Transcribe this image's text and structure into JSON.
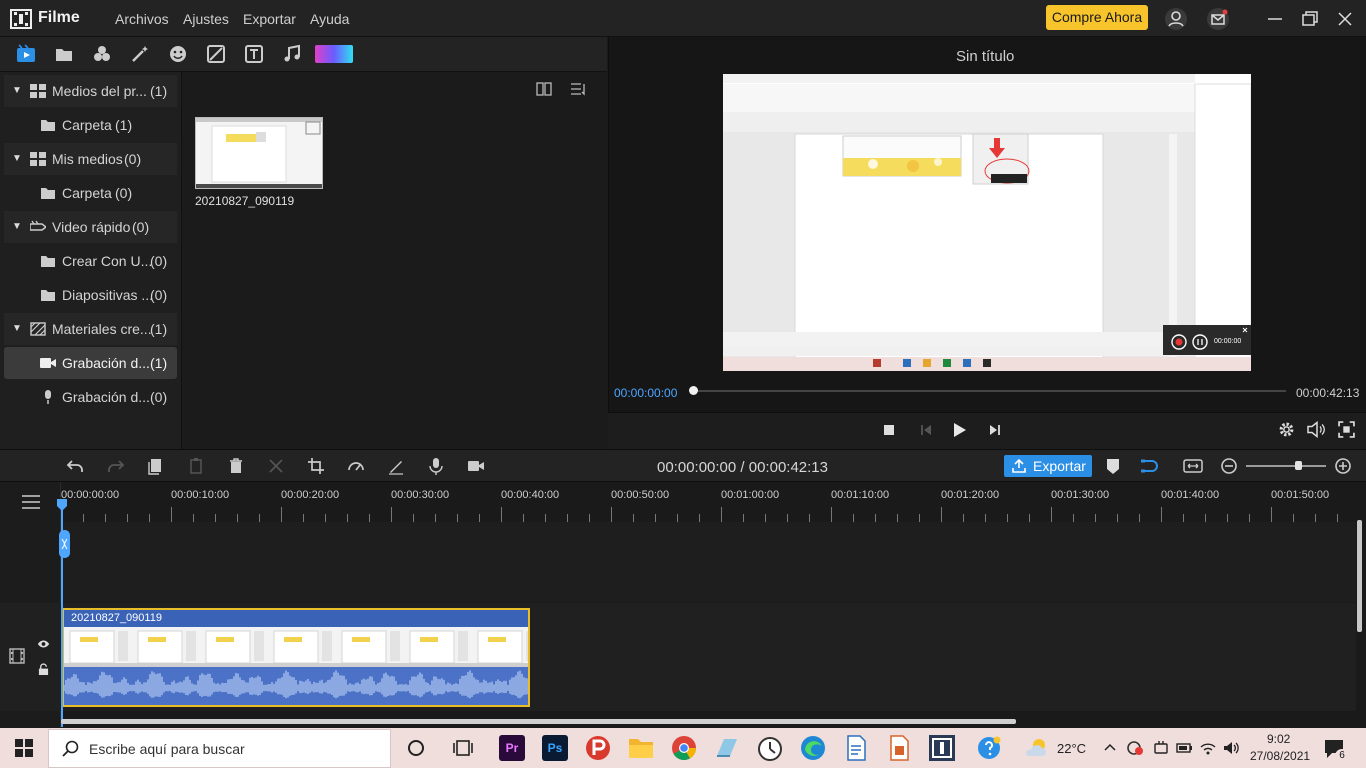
{
  "app": {
    "name": "Filme",
    "menu": [
      "Archivos",
      "Ajustes",
      "Exportar",
      "Ayuda"
    ],
    "buy_button": "Compre Ahora",
    "brand_color": "#f7c52b",
    "accent_color": "#2b8fe6"
  },
  "media_toolbar": {
    "icons": [
      "media-icon",
      "folder-icon",
      "effects-icon",
      "magic-icon",
      "sticker-icon",
      "transitions-icon",
      "text-icon",
      "music-icon",
      "color-icon"
    ]
  },
  "sidebar": {
    "items": [
      {
        "label": "Medios del pr...",
        "count": "(1)",
        "level": 0
      },
      {
        "label": "Carpeta",
        "count": "(1)",
        "level": 1
      },
      {
        "label": "Mis medios",
        "count": "(0)",
        "level": 0
      },
      {
        "label": "Carpeta",
        "count": "(0)",
        "level": 1
      },
      {
        "label": "Video rápido",
        "count": "(0)",
        "level": 0
      },
      {
        "label": "Crear Con U...",
        "count": "(0)",
        "level": 1
      },
      {
        "label": "Diapositivas ...",
        "count": "(0)",
        "level": 1
      },
      {
        "label": "Materiales cre...",
        "count": "(1)",
        "level": 0
      },
      {
        "label": "Grabación d...",
        "count": "(1)",
        "level": 1,
        "selected": true
      },
      {
        "label": "Grabación d...",
        "count": "(0)",
        "level": 1
      }
    ]
  },
  "library": {
    "media_items": [
      {
        "name": "20210827_090119"
      }
    ]
  },
  "preview": {
    "title": "Sin título",
    "current_time": "00:00:00:00",
    "end_time": "00:00:42:13",
    "overlay_time": "00:00:00"
  },
  "timeline": {
    "timecode": "00:00:00:00 / 00:00:42:13",
    "export_label": "Exportar",
    "ruler_labels": [
      "00:00:00:00",
      "00:00:10:00",
      "00:00:20:00",
      "00:00:30:00",
      "00:00:40:00",
      "00:00:50:00",
      "00:01:00:00",
      "00:01:10:00",
      "00:01:20:00",
      "00:01:30:00",
      "00:01:40:00",
      "00:01:50:00"
    ],
    "clip_name": "20210827_090119",
    "zoom_level": 0.65
  },
  "taskbar": {
    "search_placeholder": "Escribe aquí para buscar",
    "temperature": "22°C",
    "time": "9:02",
    "date": "27/08/2021",
    "notifications": "6"
  }
}
